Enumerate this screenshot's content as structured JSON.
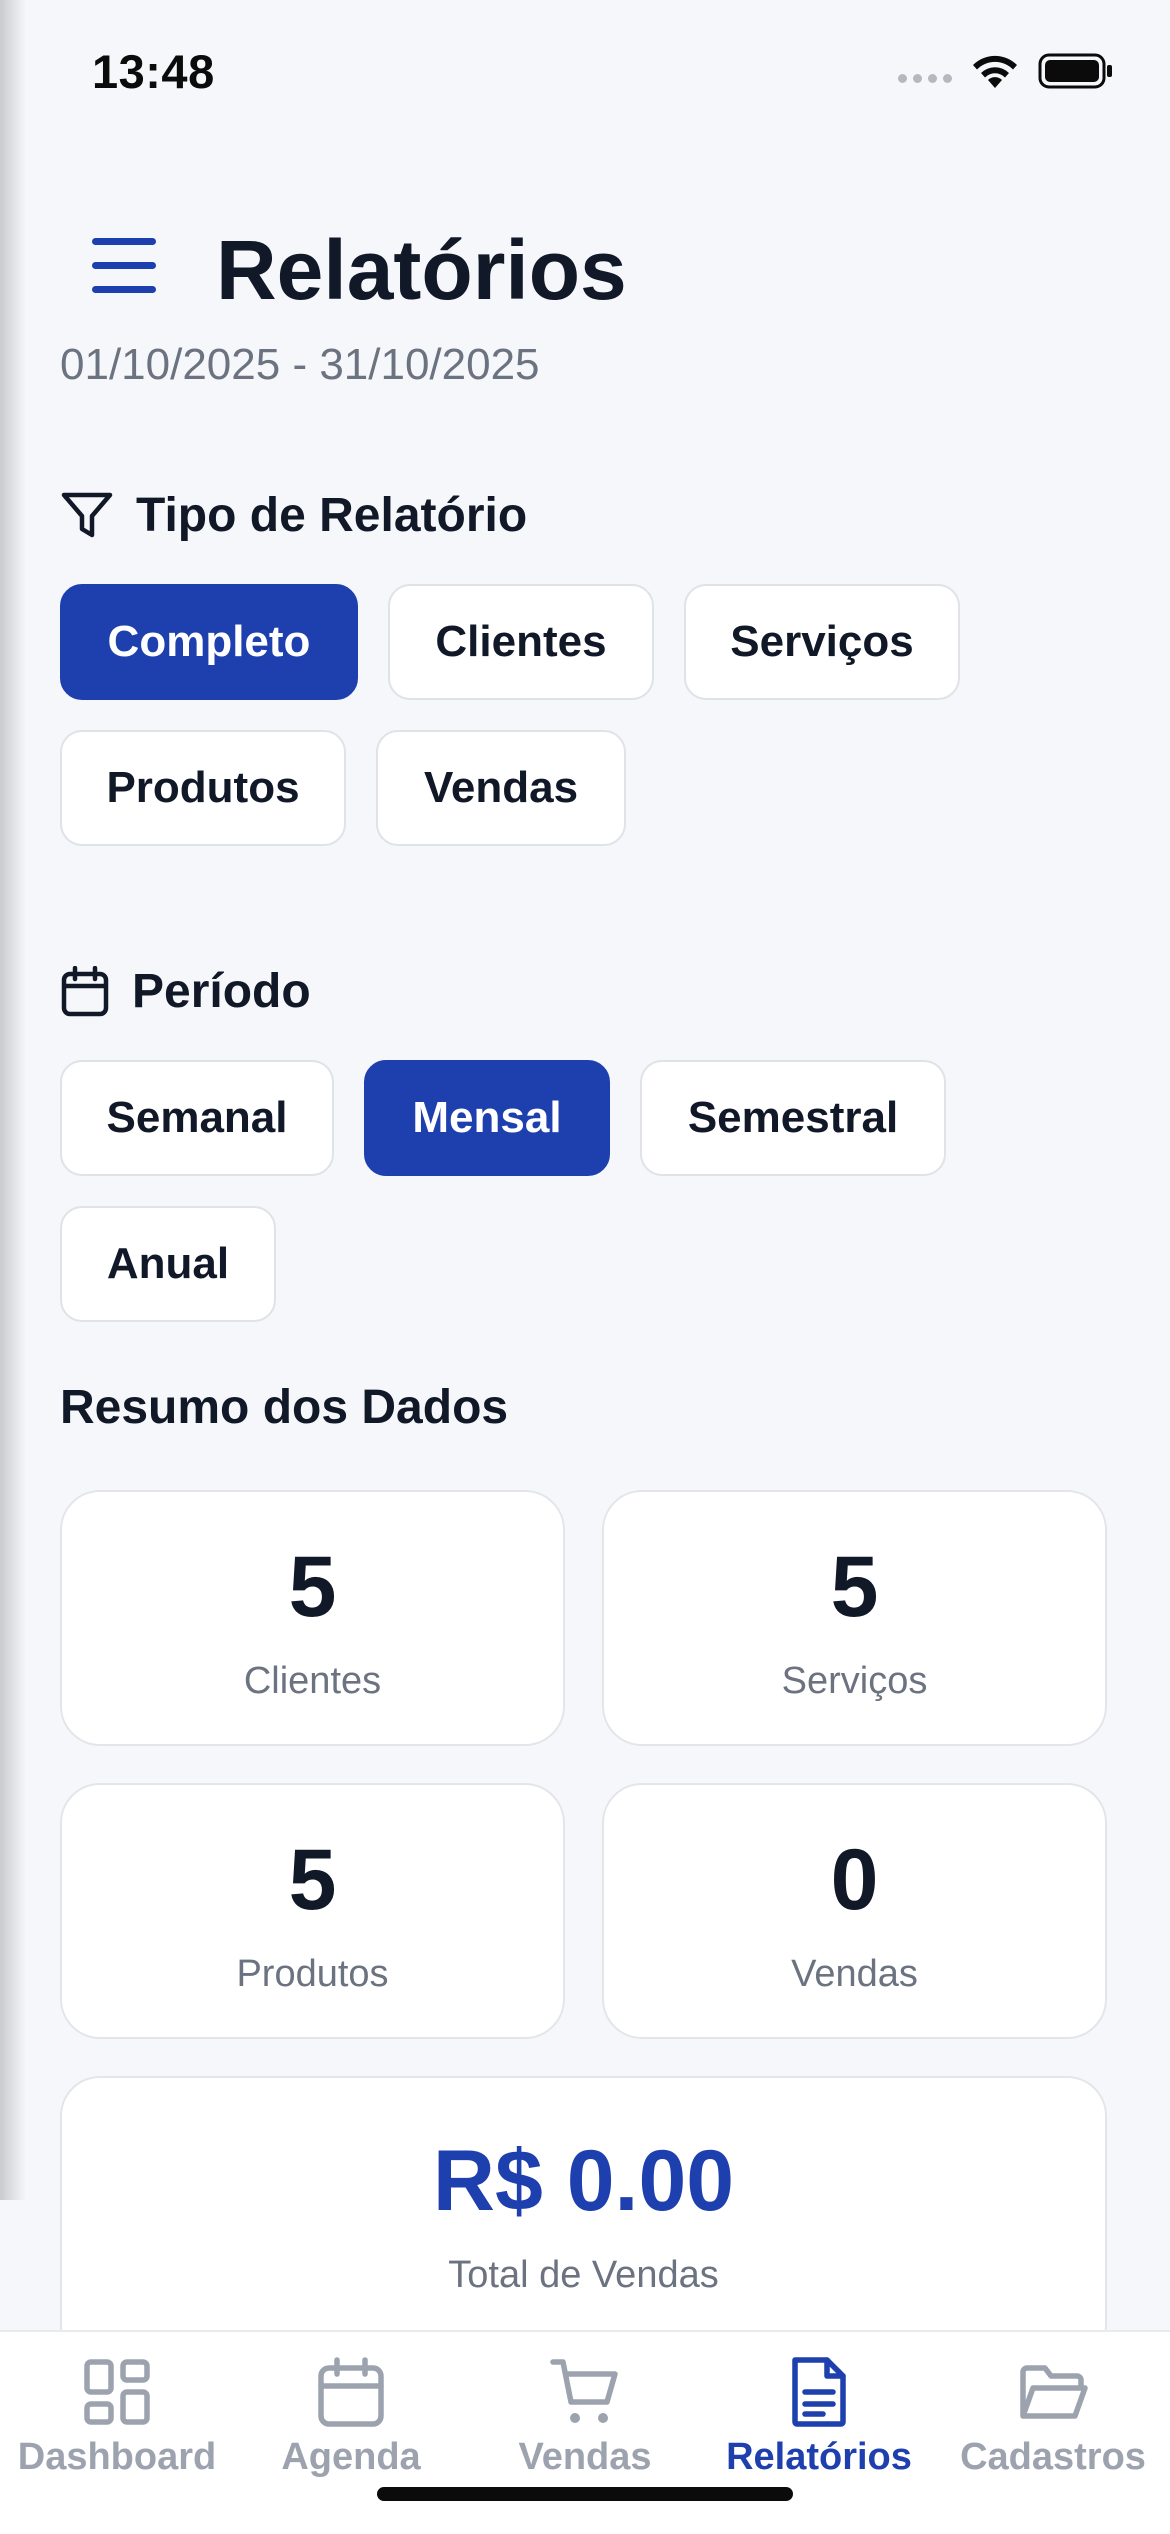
{
  "status_bar": {
    "time": "13:48"
  },
  "header": {
    "title": "Relatórios",
    "date_range": "01/10/2025 - 31/10/2025"
  },
  "report_type": {
    "title": "Tipo de Relatório",
    "options": [
      "Completo",
      "Clientes",
      "Serviços",
      "Produtos",
      "Vendas"
    ],
    "selected": "Completo"
  },
  "period": {
    "title": "Período",
    "options": [
      "Semanal",
      "Mensal",
      "Semestral",
      "Anual"
    ],
    "selected": "Mensal"
  },
  "summary": {
    "title": "Resumo dos Dados",
    "cards": [
      {
        "value": "5",
        "label": "Clientes"
      },
      {
        "value": "5",
        "label": "Serviços"
      },
      {
        "value": "5",
        "label": "Produtos"
      },
      {
        "value": "0",
        "label": "Vendas"
      }
    ],
    "total": {
      "value": "R$ 0.00",
      "label": "Total de Vendas"
    }
  },
  "tab_bar": {
    "items": [
      {
        "label": "Dashboard",
        "icon": "dashboard-grid-icon"
      },
      {
        "label": "Agenda",
        "icon": "calendar-icon"
      },
      {
        "label": "Vendas",
        "icon": "cart-icon"
      },
      {
        "label": "Relatórios",
        "icon": "document-icon"
      },
      {
        "label": "Cadastros",
        "icon": "folder-icon"
      }
    ],
    "active": "Relatórios"
  },
  "colors": {
    "accent": "#1e3fae",
    "muted": "#9ca3af",
    "background": "#f6f7fa"
  }
}
